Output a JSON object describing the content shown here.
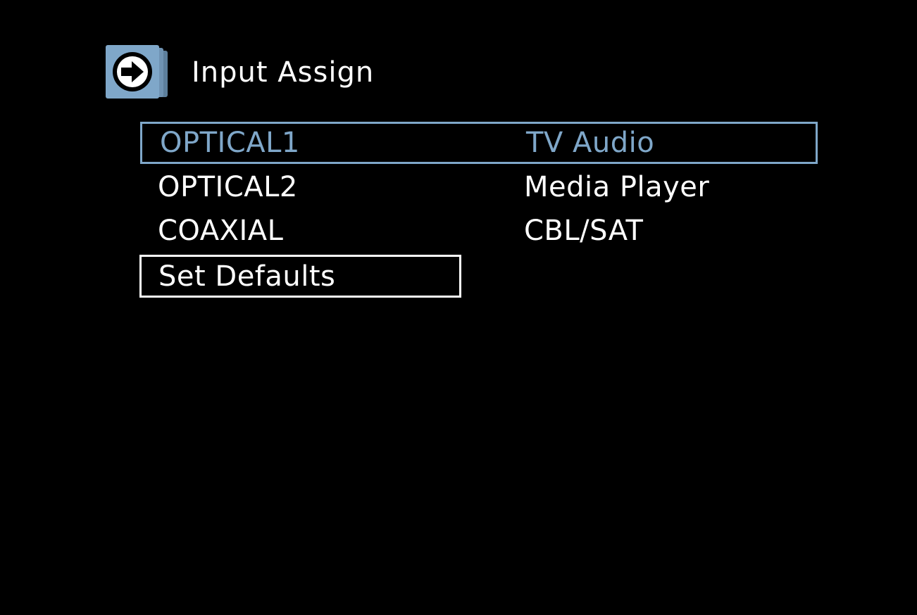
{
  "header": {
    "title": "Input Assign",
    "icon": "arrow-right-icon",
    "icon_color": "#7fa7c9"
  },
  "menu": {
    "rows": [
      {
        "input": "OPTICAL1",
        "source": "TV Audio",
        "selected": true
      },
      {
        "input": "OPTICAL2",
        "source": "Media Player",
        "selected": false
      },
      {
        "input": "COAXIAL",
        "source": "CBL/SAT",
        "selected": false
      }
    ],
    "defaults_label": "Set Defaults"
  },
  "colors": {
    "background": "#000000",
    "accent": "#7fa7c9",
    "text": "#ffffff"
  }
}
